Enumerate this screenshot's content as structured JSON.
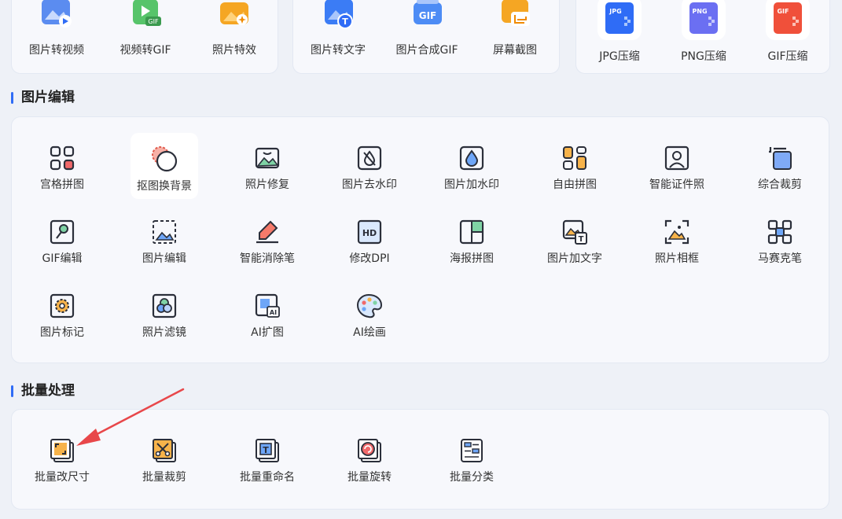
{
  "top_groups": [
    {
      "items": [
        {
          "label": "图片转视频",
          "icon": "image-to-video-icon"
        },
        {
          "label": "视频转GIF",
          "icon": "video-to-gif-icon"
        },
        {
          "label": "照片特效",
          "icon": "photo-effects-icon"
        }
      ]
    },
    {
      "items": [
        {
          "label": "图片转文字",
          "icon": "image-to-text-icon"
        },
        {
          "label": "图片合成GIF",
          "icon": "images-to-gif-icon"
        },
        {
          "label": "屏幕截图",
          "icon": "screenshot-icon"
        }
      ]
    },
    {
      "items": [
        {
          "label": "JPG压缩",
          "icon": "jpg-compress-icon",
          "badge": "JPG"
        },
        {
          "label": "PNG压缩",
          "icon": "png-compress-icon",
          "badge": "PNG"
        },
        {
          "label": "GIF压缩",
          "icon": "gif-compress-icon",
          "badge": "GIF"
        }
      ]
    }
  ],
  "image_edit": {
    "title": "图片编辑",
    "items": [
      {
        "label": "宫格拼图",
        "icon": "grid-collage-icon"
      },
      {
        "label": "抠图换背景",
        "icon": "cutout-background-icon"
      },
      {
        "label": "照片修复",
        "icon": "photo-restore-icon"
      },
      {
        "label": "图片去水印",
        "icon": "remove-watermark-icon"
      },
      {
        "label": "图片加水印",
        "icon": "add-watermark-icon"
      },
      {
        "label": "自由拼图",
        "icon": "free-collage-icon"
      },
      {
        "label": "智能证件照",
        "icon": "id-photo-icon"
      },
      {
        "label": "综合裁剪",
        "icon": "crop-icon"
      },
      {
        "label": "GIF编辑",
        "icon": "gif-edit-icon"
      },
      {
        "label": "图片编辑",
        "icon": "image-edit-icon"
      },
      {
        "label": "智能消除笔",
        "icon": "eraser-pen-icon"
      },
      {
        "label": "修改DPI",
        "icon": "hd-dpi-icon"
      },
      {
        "label": "海报拼图",
        "icon": "poster-collage-icon"
      },
      {
        "label": "图片加文字",
        "icon": "add-text-icon"
      },
      {
        "label": "照片相框",
        "icon": "photo-frame-icon"
      },
      {
        "label": "马赛克笔",
        "icon": "mosaic-pen-icon"
      },
      {
        "label": "图片标记",
        "icon": "image-mark-icon"
      },
      {
        "label": "照片滤镜",
        "icon": "photo-filter-icon"
      },
      {
        "label": "AI扩图",
        "icon": "ai-expand-icon"
      },
      {
        "label": "AI绘画",
        "icon": "ai-paint-icon"
      }
    ]
  },
  "batch": {
    "title": "批量处理",
    "items": [
      {
        "label": "批量改尺寸",
        "icon": "batch-resize-icon"
      },
      {
        "label": "批量裁剪",
        "icon": "batch-crop-icon"
      },
      {
        "label": "批量重命名",
        "icon": "batch-rename-icon"
      },
      {
        "label": "批量旋转",
        "icon": "batch-rotate-icon"
      },
      {
        "label": "批量分类",
        "icon": "batch-classify-icon"
      }
    ]
  },
  "colors": {
    "accent": "#2f6cf6",
    "annotation_arrow": "#e8474a",
    "icon_stroke": "#2b2f3a"
  }
}
